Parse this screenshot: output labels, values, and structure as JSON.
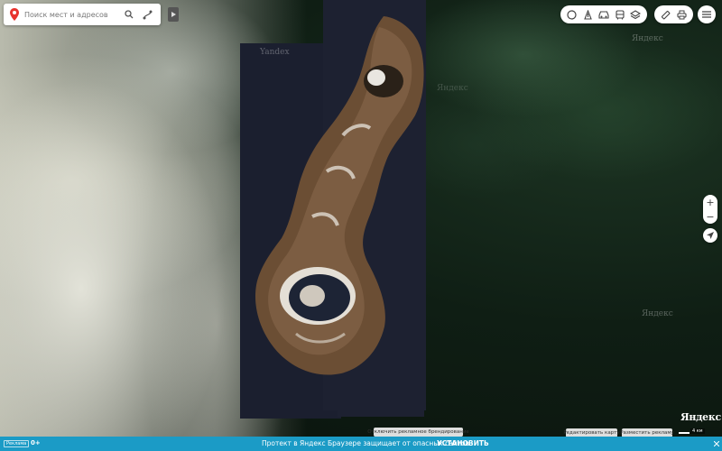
{
  "search": {
    "placeholder": "Поиск мест и адресов"
  },
  "map": {
    "watermark": "Yandex",
    "watermark_2": "Яндекс",
    "logo": "Яндекс",
    "scale_label": "4 км",
    "branding_button": "Отключить рекламное брендирование",
    "edit_map_button": "Редактировать карту",
    "place_ad_button": "Разместить рекламу"
  },
  "controls": {
    "layers": [
      "metro-icon",
      "traffic-icon",
      "car-icon",
      "bus-icon",
      "layers-icon"
    ],
    "tools": [
      "ruler-icon",
      "print-icon"
    ],
    "zoom_in": "+",
    "zoom_out": "−"
  },
  "promo": {
    "ad_badge": "Реклама",
    "age": "0+",
    "text": "Протект в Яндекс Браузере защищает от опасных сайтов",
    "install": "УСТАНОВИТЬ"
  },
  "colors": {
    "accent": "#1b9bc6",
    "pin": "#e8332e"
  }
}
